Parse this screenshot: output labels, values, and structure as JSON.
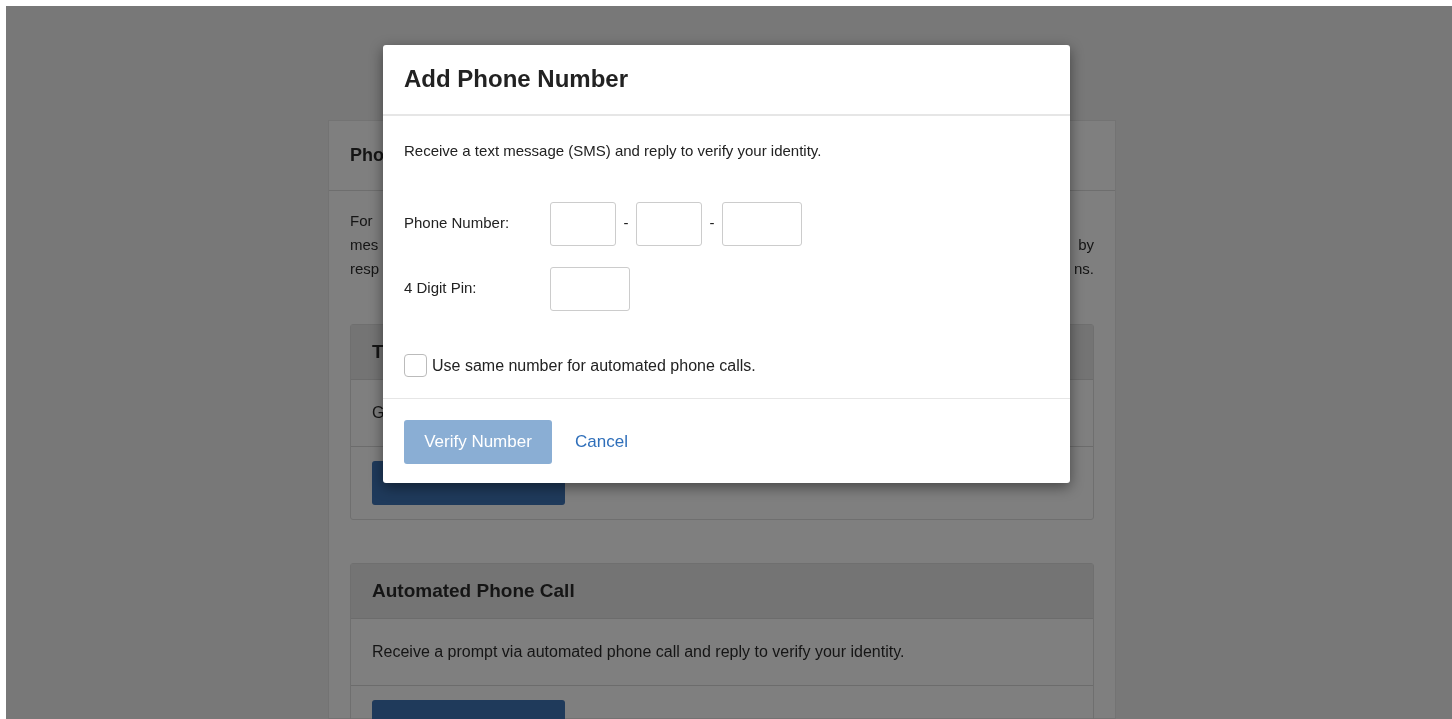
{
  "background_panel": {
    "heading": "Pho",
    "intro_lines": [
      {
        "left": "For"
      },
      {
        "left": "mes",
        "right": "by"
      },
      {
        "left": "resp",
        "right": "ns."
      }
    ],
    "cards": [
      {
        "heading": "T",
        "body": "G"
      },
      {
        "heading": "Automated Phone Call",
        "body": "Receive a prompt via automated phone call and reply to verify your identity."
      }
    ]
  },
  "modal": {
    "title": "Add Phone Number",
    "description": "Receive a text message (SMS) and reply to verify your identity.",
    "phone_label": "Phone Number:",
    "phone_separators": [
      "-",
      "-"
    ],
    "pin_label": "4 Digit Pin:",
    "checkbox": {
      "label": "Use same number for automated phone calls.",
      "checked": false
    },
    "verify_button": {
      "label": "Verify Number",
      "disabled": true
    },
    "cancel_link": "Cancel"
  }
}
